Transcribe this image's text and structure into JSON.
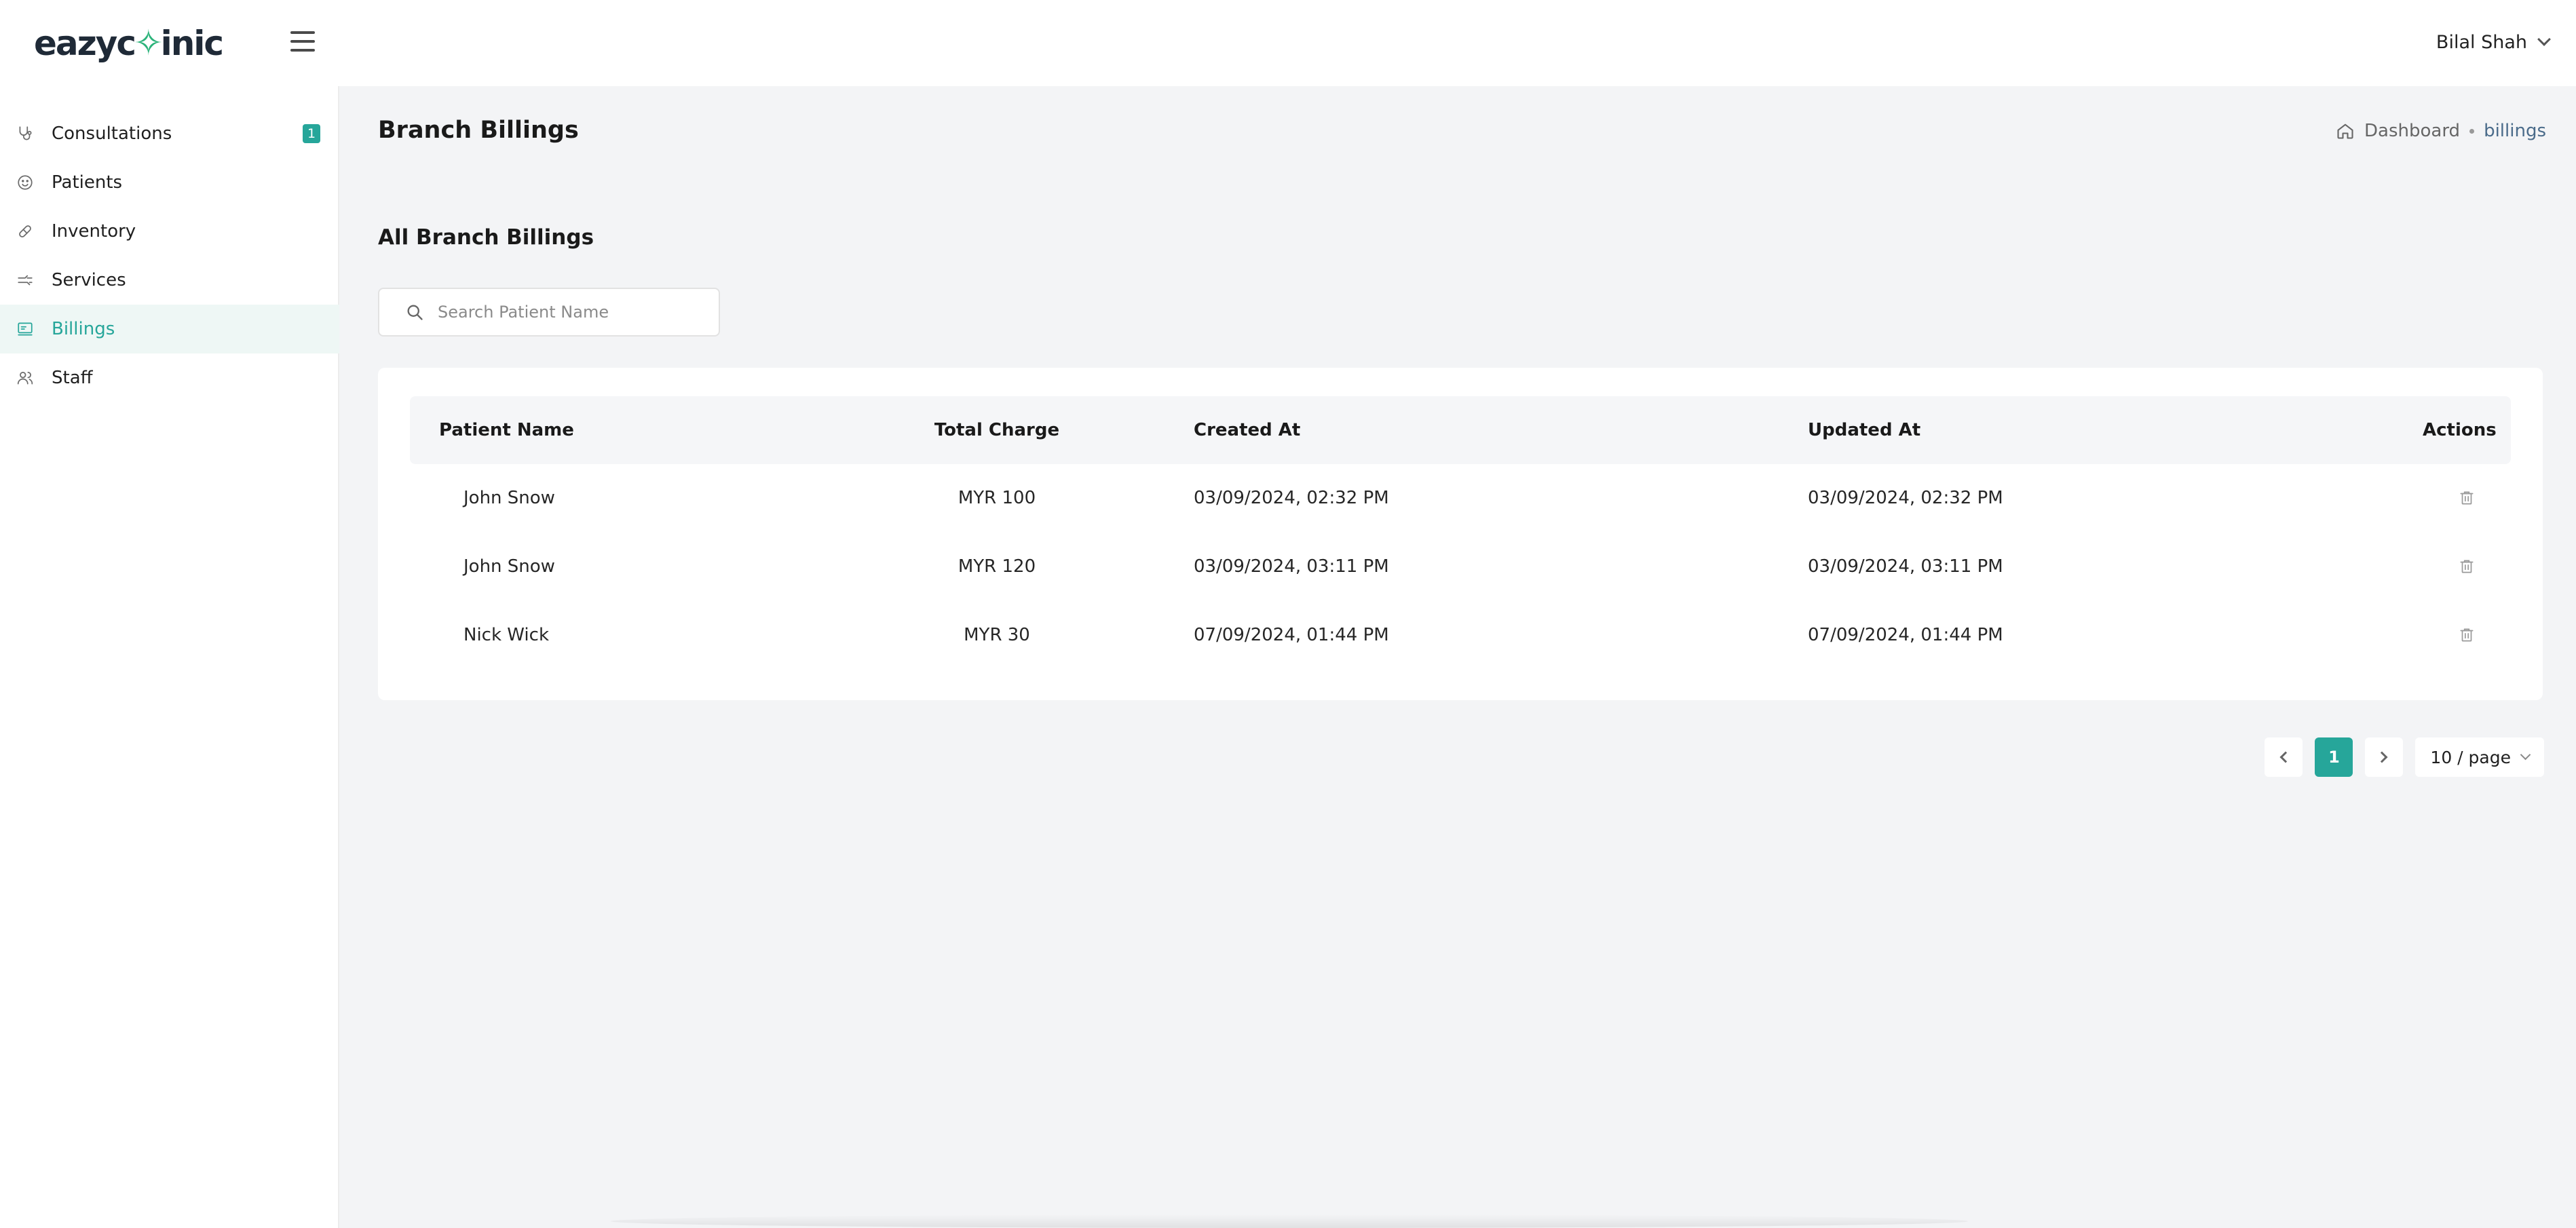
{
  "header": {
    "logo_text_left": "eazyc",
    "logo_mark": "✧",
    "logo_text_right": "inic",
    "user_name": "Bilal Shah"
  },
  "sidebar": {
    "items": [
      {
        "label": "Consultations",
        "icon": "stethoscope-icon",
        "badge": "1"
      },
      {
        "label": "Patients",
        "icon": "smiley-icon"
      },
      {
        "label": "Inventory",
        "icon": "pill-icon"
      },
      {
        "label": "Services",
        "icon": "services-icon"
      },
      {
        "label": "Billings",
        "icon": "billing-icon",
        "active": true
      },
      {
        "label": "Staff",
        "icon": "users-icon"
      }
    ]
  },
  "page": {
    "title": "Branch Billings",
    "breadcrumb_home": "Dashboard",
    "breadcrumb_current": "billings",
    "section_title": "All Branch Billings",
    "search_placeholder": "Search Patient Name"
  },
  "table": {
    "columns": [
      "Patient Name",
      "Total Charge",
      "Created At",
      "Updated At",
      "Actions"
    ],
    "rows": [
      {
        "patient": "John Snow",
        "charge": "MYR 100",
        "created": "03/09/2024, 02:32 PM",
        "updated": "03/09/2024, 02:32 PM"
      },
      {
        "patient": "John Snow",
        "charge": "MYR 120",
        "created": "03/09/2024, 03:11 PM",
        "updated": "03/09/2024, 03:11 PM"
      },
      {
        "patient": "Nick Wick",
        "charge": "MYR 30",
        "created": "07/09/2024, 01:44 PM",
        "updated": "07/09/2024, 01:44 PM"
      }
    ]
  },
  "pagination": {
    "current_page": "1",
    "page_size": "10 / page"
  },
  "colors": {
    "accent": "#26a69a",
    "active_bg": "#eef7f5",
    "page_bg": "#f3f4f6"
  }
}
